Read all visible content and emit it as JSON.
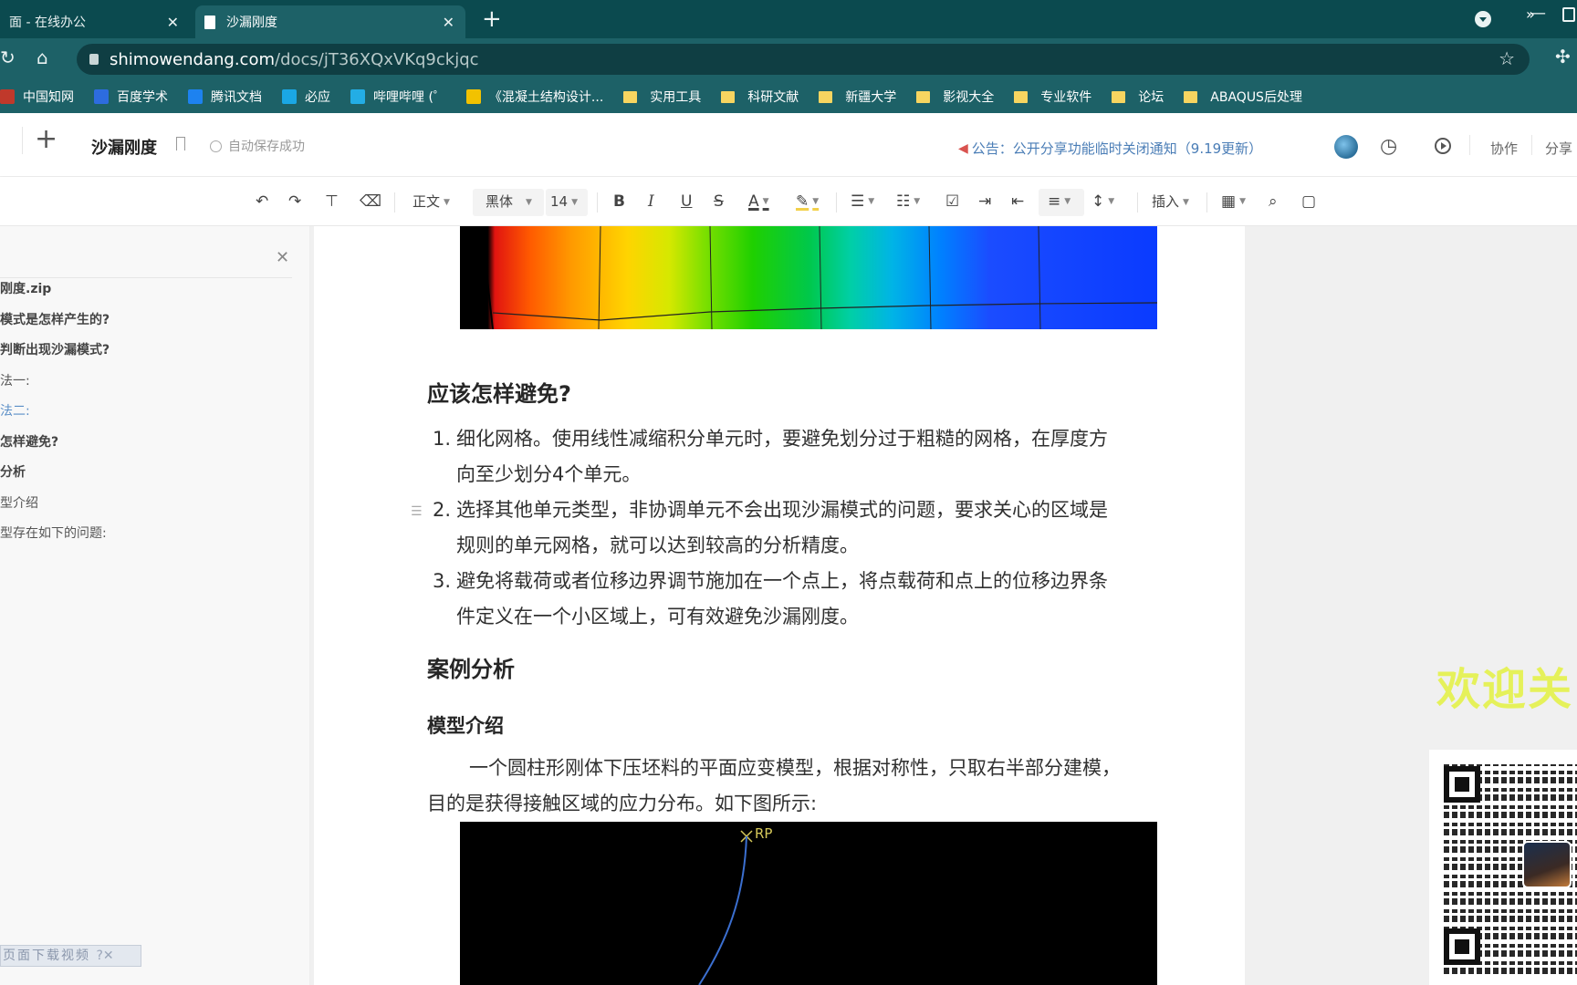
{
  "browser": {
    "tabs": [
      {
        "title": "面 - 在线办公"
      },
      {
        "title": "沙漏刚度"
      }
    ],
    "url_domain": "shimowendang.com",
    "url_path": "/docs/jT36XQxVKq9ckjqc",
    "bookmarks": [
      {
        "label": "中国知网",
        "color": "#c0392b"
      },
      {
        "label": "百度学术",
        "color": "#2d6cdf"
      },
      {
        "label": "腾讯文档",
        "color": "#1d82f0"
      },
      {
        "label": "必应",
        "color": "#1aa7e5"
      },
      {
        "label": "哔哩哔哩 (゜",
        "color": "#23ade5"
      },
      {
        "label": "《混凝土结构设计...",
        "color": "#f2c200"
      },
      {
        "label": "实用工具",
        "folder": true
      },
      {
        "label": "科研文献",
        "folder": true
      },
      {
        "label": "新疆大学",
        "folder": true
      },
      {
        "label": "影视大全",
        "folder": true
      },
      {
        "label": "专业软件",
        "folder": true
      },
      {
        "label": "论坛",
        "folder": true
      },
      {
        "label": "ABAQUS后处理",
        "folder": true
      }
    ]
  },
  "doc_header": {
    "title": "沙漏刚度",
    "autosave": "自动保存成功",
    "notice": "公告：公开分享功能临时关闭通知（9.19更新）",
    "collab": "协作",
    "share": "分享"
  },
  "toolbar": {
    "style": "正文",
    "font": "黑体",
    "size": "14",
    "insert": "插入"
  },
  "outline": {
    "items": [
      {
        "label": "刚度.zip",
        "bold": true
      },
      {
        "label": "模式是怎样产生的?",
        "bold": true
      },
      {
        "label": "判断出现沙漏模式?",
        "bold": true
      },
      {
        "label": "法一:",
        "bold": false
      },
      {
        "label": "法二:",
        "bold": false,
        "active": true
      },
      {
        "label": "怎样避免?",
        "bold": true
      },
      {
        "label": "分析",
        "bold": true
      },
      {
        "label": "型介绍",
        "bold": false
      },
      {
        "label": "型存在如下的问题:",
        "bold": false
      }
    ],
    "download_bar": "页面下载视频"
  },
  "document": {
    "heading_avoid": "应该怎样避免?",
    "list": [
      {
        "num": "1.",
        "text": "细化网格。使用线性减缩积分单元时，要避免划分过于粗糙的网格，在厚度方向至少划分4个单元。"
      },
      {
        "num": "2.",
        "text": "选择其他单元类型，非协调单元不会出现沙漏模式的问题，要求关心的区域是规则的单元网格，就可以达到较高的分析精度。"
      },
      {
        "num": "3.",
        "text": "避免将载荷或者位移边界调节施加在一个点上，将点载荷和点上的位移边界条件定义在一个小区域上，可有效避免沙漏刚度。"
      }
    ],
    "heading_case": "案例分析",
    "heading_model": "模型介绍",
    "model_paragraph": "一个圆柱形刚体下压坯料的平面应变模型，根据对称性，只取右半部分建模，目的是获得接触区域的应力分布。如下图所示:",
    "figure_label": "RP"
  },
  "overlay": {
    "welcome": "欢迎关"
  }
}
